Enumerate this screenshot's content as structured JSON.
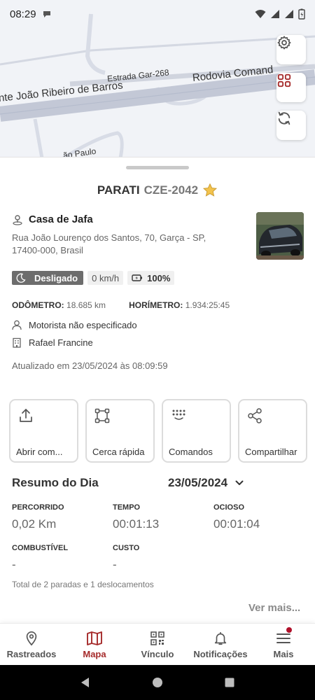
{
  "status_bar": {
    "time": "08:29"
  },
  "map": {
    "road_1": "Estrada Gar-268",
    "road_2": "nte João Ribeiro de Barros",
    "road_3": "Rodovia Comand",
    "road_4": "Estrada Gar-268",
    "road_5": "ão Paulo"
  },
  "vehicle": {
    "name": "PARATI",
    "plate": "CZE-2042",
    "place": "Casa de Jafa",
    "address": "Rua João Lourenço dos Santos, 70, Garça - SP, 17400-000, Brasil",
    "ignition": "Desligado",
    "speed": "0 km/h",
    "battery": "100%",
    "odometer_label": "ODÔMETRO:",
    "odometer_value": "18.685 km",
    "hourmeter_label": "HORÍMETRO:",
    "hourmeter_value": "1.934:25:45",
    "driver": "Motorista não especificado",
    "owner": "Rafael Francine",
    "updated": "Atualizado em 23/05/2024 às 08:09:59"
  },
  "actions": [
    {
      "label": "Abrir com...",
      "icon": "share-out-icon"
    },
    {
      "label": "Cerca rápida",
      "icon": "fence-icon"
    },
    {
      "label": "Comandos",
      "icon": "commands-icon"
    },
    {
      "label": "Compartilhar",
      "icon": "share-icon"
    }
  ],
  "summary": {
    "title": "Resumo do Dia",
    "date": "23/05/2024",
    "stats": {
      "percorrido_label": "PERCORRIDO",
      "percorrido_value": "0,02 Km",
      "tempo_label": "TEMPO",
      "tempo_value": "00:01:13",
      "ocioso_label": "OCIOSO",
      "ocioso_value": "00:01:04",
      "combustivel_label": "COMBUSTÍVEL",
      "combustivel_value": "-",
      "custo_label": "CUSTO",
      "custo_value": "-"
    },
    "totals": "Total de 2 paradas e 1 deslocamentos",
    "see_more": "Ver mais..."
  },
  "nav": [
    {
      "label": "Rastreados",
      "icon": "location-pin-icon"
    },
    {
      "label": "Mapa",
      "icon": "map-icon"
    },
    {
      "label": "Vínculo",
      "icon": "qr-code-icon"
    },
    {
      "label": "Notificações",
      "icon": "bell-icon"
    },
    {
      "label": "Mais",
      "icon": "menu-icon"
    }
  ],
  "colors": {
    "accent": "#a52a2a",
    "map_bg": "#f1f3f7",
    "road": "#c8ccd8"
  }
}
